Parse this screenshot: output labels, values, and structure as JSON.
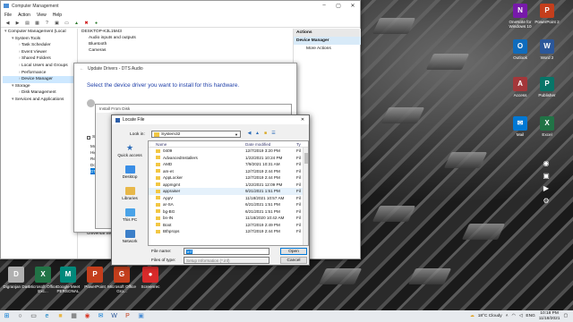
{
  "cm": {
    "title": "Computer Management",
    "menu": [
      "File",
      "Action",
      "View",
      "Help"
    ],
    "tree": [
      {
        "label": "Computer Management (Local",
        "indent": 0,
        "selected": false
      },
      {
        "label": "System Tools",
        "indent": 1,
        "selected": false
      },
      {
        "label": "Task Scheduler",
        "indent": 2,
        "selected": false
      },
      {
        "label": "Event Viewer",
        "indent": 2,
        "selected": false
      },
      {
        "label": "Shared Folders",
        "indent": 2,
        "selected": false
      },
      {
        "label": "Local Users and Groups",
        "indent": 2,
        "selected": false
      },
      {
        "label": "Performance",
        "indent": 2,
        "selected": false
      },
      {
        "label": "Device Manager",
        "indent": 2,
        "selected": true
      },
      {
        "label": "Storage",
        "indent": 1,
        "selected": false
      },
      {
        "label": "Disk Management",
        "indent": 2,
        "selected": false
      },
      {
        "label": "Services and Applications",
        "indent": 1,
        "selected": false
      }
    ],
    "device_tree": [
      "DESKTOP-K3L1M43",
      "Audio inputs and outputs",
      "Bluetooth",
      "Cameras"
    ],
    "device_tree_bottom": [
      "System devices",
      "Universal Serial Bus controllers"
    ],
    "actions_header": "Actions",
    "actions_sub": "Device Manager",
    "actions_more": "More Actions"
  },
  "update_drivers": {
    "title": "Update Drivers - DTS Audio",
    "heading": "Select the device driver you want to install for this hardware.",
    "partial_text": "If you have a",
    "show_compat": "Show co",
    "model_label": "Model",
    "models": [
      "High D",
      "Realte",
      "Dolby",
      "DTS A"
    ],
    "link": "Tell me"
  },
  "install_from_disk": {
    "title": "Install From Disk"
  },
  "locate_file": {
    "title": "Locate File",
    "look_in_label": "Look in:",
    "look_in_value": "System32",
    "places": [
      "Quick access",
      "Desktop",
      "Libraries",
      "This PC",
      "Network"
    ],
    "columns": {
      "name": "Name",
      "date": "Date modified",
      "type": "Ty"
    },
    "files": [
      {
        "name": "0409",
        "date": "12/7/2019 3:20 PM",
        "type": "Fil"
      },
      {
        "name": "AdvancedInstallers",
        "date": "1/22/2021 10:24 PM",
        "type": "Fil"
      },
      {
        "name": "AMD",
        "date": "7/9/2021 10:31 AM",
        "type": "Fil"
      },
      {
        "name": "am-et",
        "date": "12/7/2019 2:44 PM",
        "type": "Fil"
      },
      {
        "name": "AppLocker",
        "date": "12/7/2019 2:44 PM",
        "type": "Fil"
      },
      {
        "name": "appmgmt",
        "date": "1/22/2021 12:09 PM",
        "type": "Fil"
      },
      {
        "name": "appraiser",
        "date": "9/21/2021 1:51 PM",
        "type": "Fil"
      },
      {
        "name": "AppV",
        "date": "11/18/2021 10:57 AM",
        "type": "Fil"
      },
      {
        "name": "ar-SA",
        "date": "6/21/2021 1:51 PM",
        "type": "Fil"
      },
      {
        "name": "bg-BG",
        "date": "6/21/2021 1:51 PM",
        "type": "Fil"
      },
      {
        "name": "bn-IN",
        "date": "11/18/2020 10:42 AM",
        "type": "Fil"
      },
      {
        "name": "Boot",
        "date": "12/7/2019 2:49 PM",
        "type": "Fil"
      },
      {
        "name": "Bthprops",
        "date": "12/7/2019 2:44 PM",
        "type": "Fil"
      }
    ],
    "file_name_label": "File name:",
    "file_name_value": "inf",
    "file_type_label": "Files of type:",
    "file_type_value": "Setup Information (*.inf)",
    "open_label": "Open",
    "cancel_label": "Cancel"
  },
  "desktop_icons_right": [
    {
      "label": "OneNote for Windows 10",
      "glyph": "N",
      "color": "#7719aa"
    },
    {
      "label": "PowerPoint 2",
      "glyph": "P",
      "color": "#c43e1c"
    },
    {
      "label": "Outlook",
      "glyph": "O",
      "color": "#0f6cbd"
    },
    {
      "label": "Word 2",
      "glyph": "W",
      "color": "#2b579a"
    },
    {
      "label": "Access",
      "glyph": "A",
      "color": "#a4373a"
    },
    {
      "label": "Publisher",
      "glyph": "P",
      "color": "#077568"
    },
    {
      "label": "Mail",
      "glyph": "✉",
      "color": "#0078d4"
    },
    {
      "label": "Excel",
      "glyph": "X",
      "color": "#217346"
    }
  ],
  "desktop_icons_bottom": [
    {
      "label": "Digranjan Das",
      "glyph": "D",
      "color": "#b0b0b0"
    },
    {
      "label": "Microsoft Office Exc...",
      "glyph": "X",
      "color": "#217346"
    },
    {
      "label": "Google Meet PERSONAL",
      "glyph": "M",
      "color": "#00897b"
    },
    {
      "label": "PowerPoint",
      "glyph": "P",
      "color": "#c43e1c"
    },
    {
      "label": "Microsoft Office Gro...",
      "glyph": "G",
      "color": "#c43e1c"
    },
    {
      "label": "Screenrec",
      "glyph": "●",
      "color": "#d92b2b"
    }
  ],
  "taskbar": {
    "weather": "18°C Cloudy",
    "time": "10:18 PM",
    "date": "11/18/2021",
    "lang": "ENG"
  }
}
